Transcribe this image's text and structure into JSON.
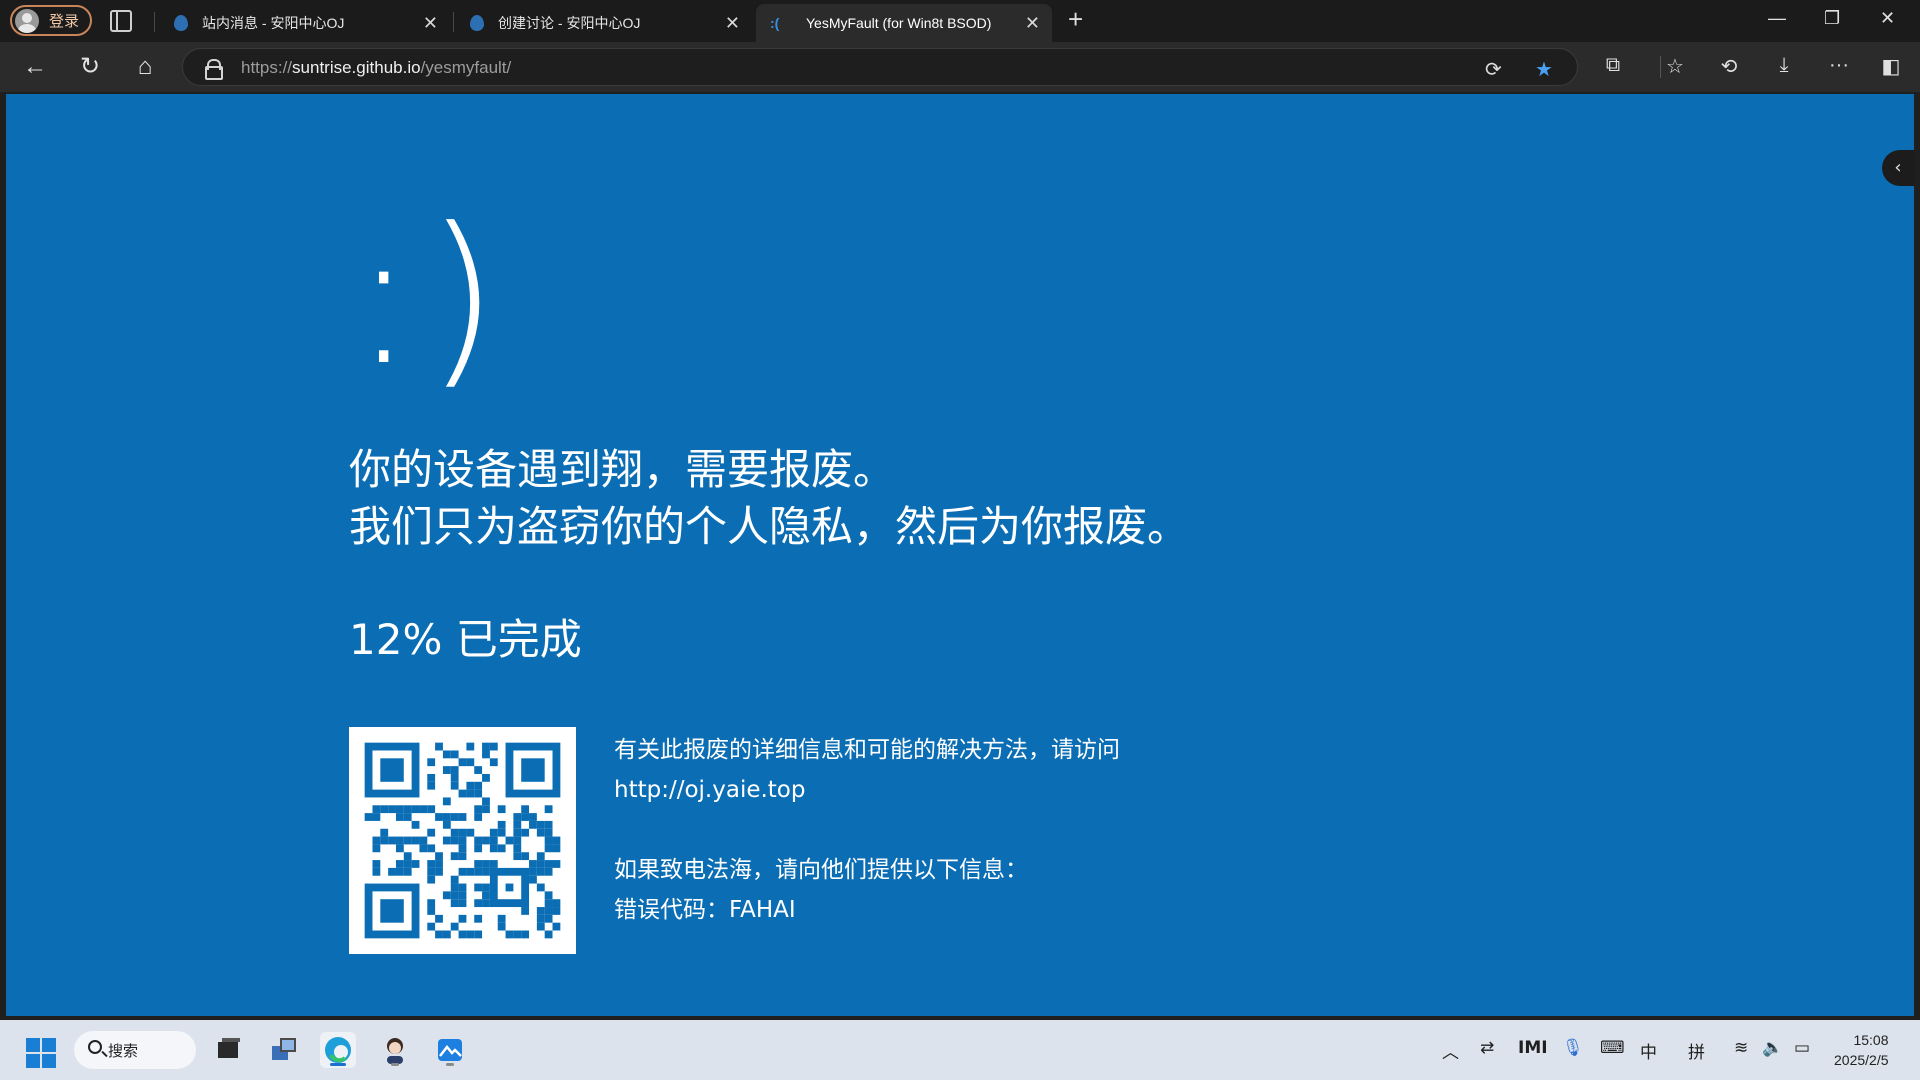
{
  "profile": {
    "label": "登录"
  },
  "tabs": [
    {
      "title": "站内消息 - 安阳中心OJ",
      "active": false
    },
    {
      "title": "创建讨论 - 安阳中心OJ",
      "active": false
    },
    {
      "title": "YesMyFault (for Win8t BSOD)",
      "active": true,
      "favicon_text": ":("
    }
  ],
  "address_bar": {
    "scheme": "https://",
    "host": "suntrise.github.io",
    "path": "/yesmyfault/"
  },
  "bsod": {
    "face": ":)",
    "line1": "你的设备遇到翔，需要报废。",
    "line2": "我们只为盗窃你的个人隐私，然后为你报废。",
    "progress": "12% 已完成",
    "progress_value": 12,
    "info_line1": "有关此报废的详细信息和可能的解决方法，请访问",
    "info_url": "http://oj.yaie.top",
    "info_line2": "如果致电法海，请向他们提供以下信息：",
    "error_code": "错误代码：FAHAI",
    "background_color": "#0b6eb4"
  },
  "taskbar": {
    "search_label": "搜索",
    "ime_mode": "中",
    "ime_name": "拼",
    "time": "15:08",
    "date": "2025/2/5"
  }
}
